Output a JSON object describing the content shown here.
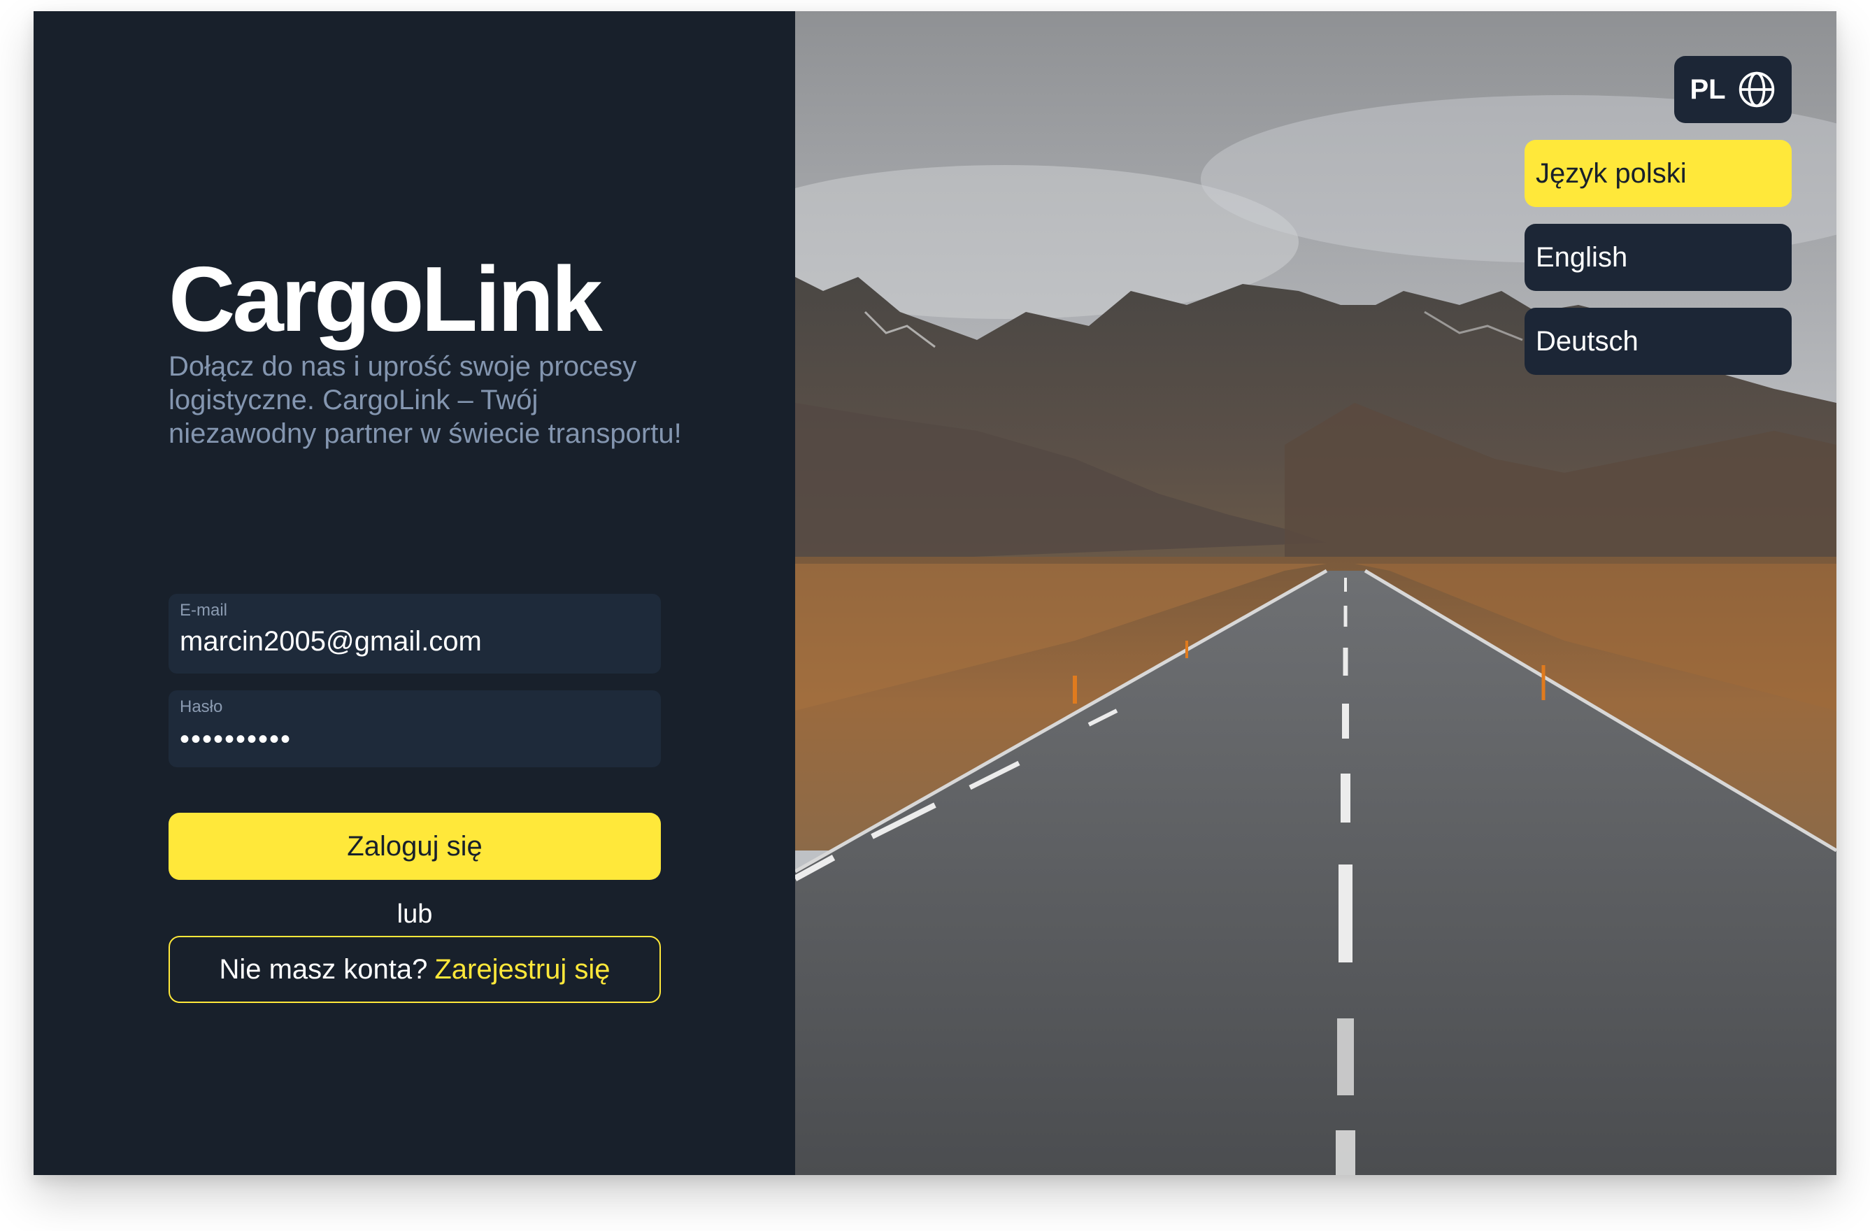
{
  "brand": {
    "name": "CargoLink"
  },
  "hero": {
    "tagline": "Dołącz do nas i uprość swoje procesy logistyczne. CargoLink – Twój niezawodny partner w świecie transportu!"
  },
  "login_form": {
    "email": {
      "label": "E-mail",
      "value": "marcin2005@gmail.com"
    },
    "password": {
      "label": "Hasło",
      "value": "••••••••••"
    },
    "login_button": "Zaloguj się",
    "separator": "lub",
    "register_prompt": "Nie masz konta?",
    "register_link": "Zarejestruj się"
  },
  "language": {
    "current": "PL",
    "icon": "globe-icon",
    "options": [
      {
        "label": "Język polski",
        "selected": true
      },
      {
        "label": "English",
        "selected": false
      },
      {
        "label": "Deutsch",
        "selected": false
      }
    ]
  },
  "colors": {
    "panel": "#18202b",
    "field": "#1e2a3a",
    "accent": "#ffe83a",
    "muted_text": "#8496b0"
  }
}
